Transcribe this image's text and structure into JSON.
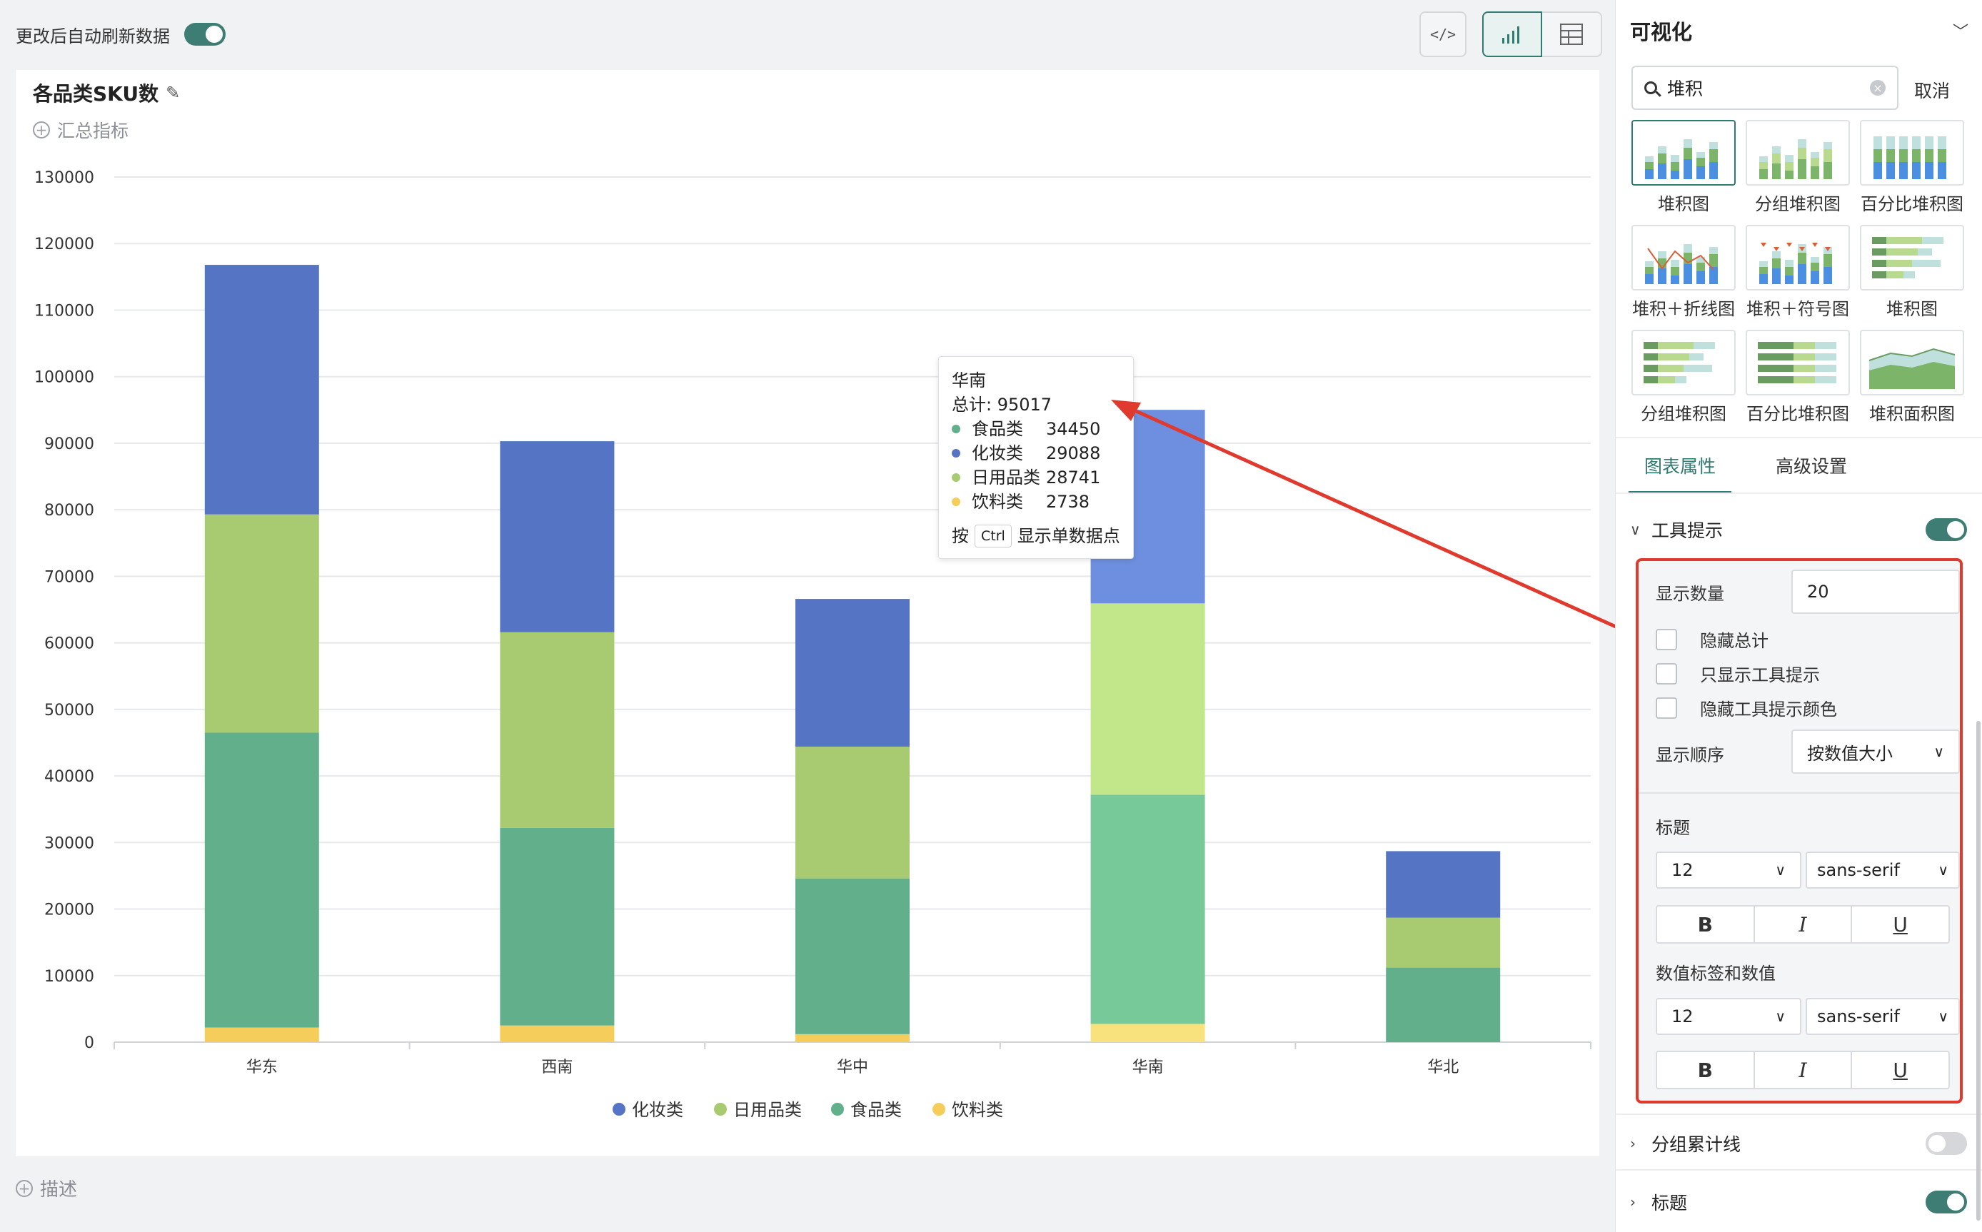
{
  "toolbar": {
    "auto_refresh_label": "更改后自动刷新数据",
    "auto_refresh_on": true,
    "code_icon": "code-icon",
    "chart_view_icon": "bar-chart-icon",
    "table_view_icon": "table-icon"
  },
  "card": {
    "title": "各品类SKU数",
    "summary_label": "汇总指标",
    "description_label": "描述"
  },
  "chart_data": {
    "type": "bar",
    "stacked": true,
    "categories": [
      "华东",
      "西南",
      "华中",
      "华南",
      "华北"
    ],
    "series": [
      {
        "name": "饮料类",
        "color": "#f4cd5b",
        "values": [
          2200,
          2500,
          1200,
          2738,
          0
        ]
      },
      {
        "name": "食品类",
        "color": "#62b08b",
        "values": [
          44300,
          29700,
          23400,
          34450,
          11200
        ]
      },
      {
        "name": "日用品类",
        "color": "#a8cb72",
        "values": [
          32800,
          29400,
          19800,
          28741,
          7500
        ]
      },
      {
        "name": "化妆类",
        "color": "#5574c4",
        "values": [
          37500,
          28700,
          22200,
          29088,
          10000
        ]
      }
    ],
    "legend_order": [
      "化妆类",
      "日用品类",
      "食品类",
      "饮料类"
    ],
    "yticks": [
      "0",
      "10000",
      "20000",
      "30000",
      "40000",
      "50000",
      "60000",
      "70000",
      "80000",
      "90000",
      "100000",
      "110000",
      "120000",
      "130000"
    ],
    "ylim": [
      0,
      130000
    ],
    "grid": true,
    "legend_position": "bottom-center",
    "highlighted_category": "华南",
    "highlight_colors": {
      "饮料类": "#f8e27e",
      "食品类": "#78c99a",
      "日用品类": "#c2e78a",
      "化妆类": "#6e8fdf"
    }
  },
  "tooltip": {
    "category": "华南",
    "total_label": "总计: 95017",
    "rows": [
      {
        "name": "食品类",
        "value": "34450",
        "color": "#62b08b"
      },
      {
        "name": "化妆类",
        "value": "29088",
        "color": "#5574c4"
      },
      {
        "name": "日用品类",
        "value": "28741",
        "color": "#a8cb72"
      },
      {
        "name": "饮料类",
        "value": "2738",
        "color": "#f4cd5b"
      }
    ],
    "hint_prefix": "按",
    "hint_key": "Ctrl",
    "hint_suffix": "显示单数据点"
  },
  "panel": {
    "title": "可视化",
    "search_value": "堆积",
    "cancel_label": "取消",
    "chart_types": [
      {
        "label": "堆积图",
        "selected": true
      },
      {
        "label": "分组堆积图",
        "selected": false
      },
      {
        "label": "百分比堆积图",
        "selected": false
      },
      {
        "label": "堆积＋折线图",
        "selected": false
      },
      {
        "label": "堆积＋符号图",
        "selected": false
      },
      {
        "label": "堆积图",
        "selected": false
      },
      {
        "label": "分组堆积图",
        "selected": false
      },
      {
        "label": "百分比堆积图",
        "selected": false
      },
      {
        "label": "堆积面积图",
        "selected": false
      }
    ],
    "tabs": [
      "图表属性",
      "高级设置"
    ],
    "tooltip_section": {
      "label": "工具提示",
      "enabled": true,
      "count_label": "显示数量",
      "count_value": "20",
      "hide_total": "隐藏总计",
      "only_tooltip": "只显示工具提示",
      "hide_color": "隐藏工具提示颜色",
      "order_label": "显示顺序",
      "order_value": "按数值大小",
      "title_label": "标题",
      "title_size": "12",
      "title_font": "sans-serif",
      "value_label": "数值标签和数值",
      "value_size": "12",
      "value_font": "sans-serif",
      "bold": "B",
      "italic": "I",
      "underline": "U"
    },
    "group_total_label": "分组累计线",
    "group_total_enabled": false,
    "title_section_label": "标题",
    "title_section_enabled": true
  }
}
